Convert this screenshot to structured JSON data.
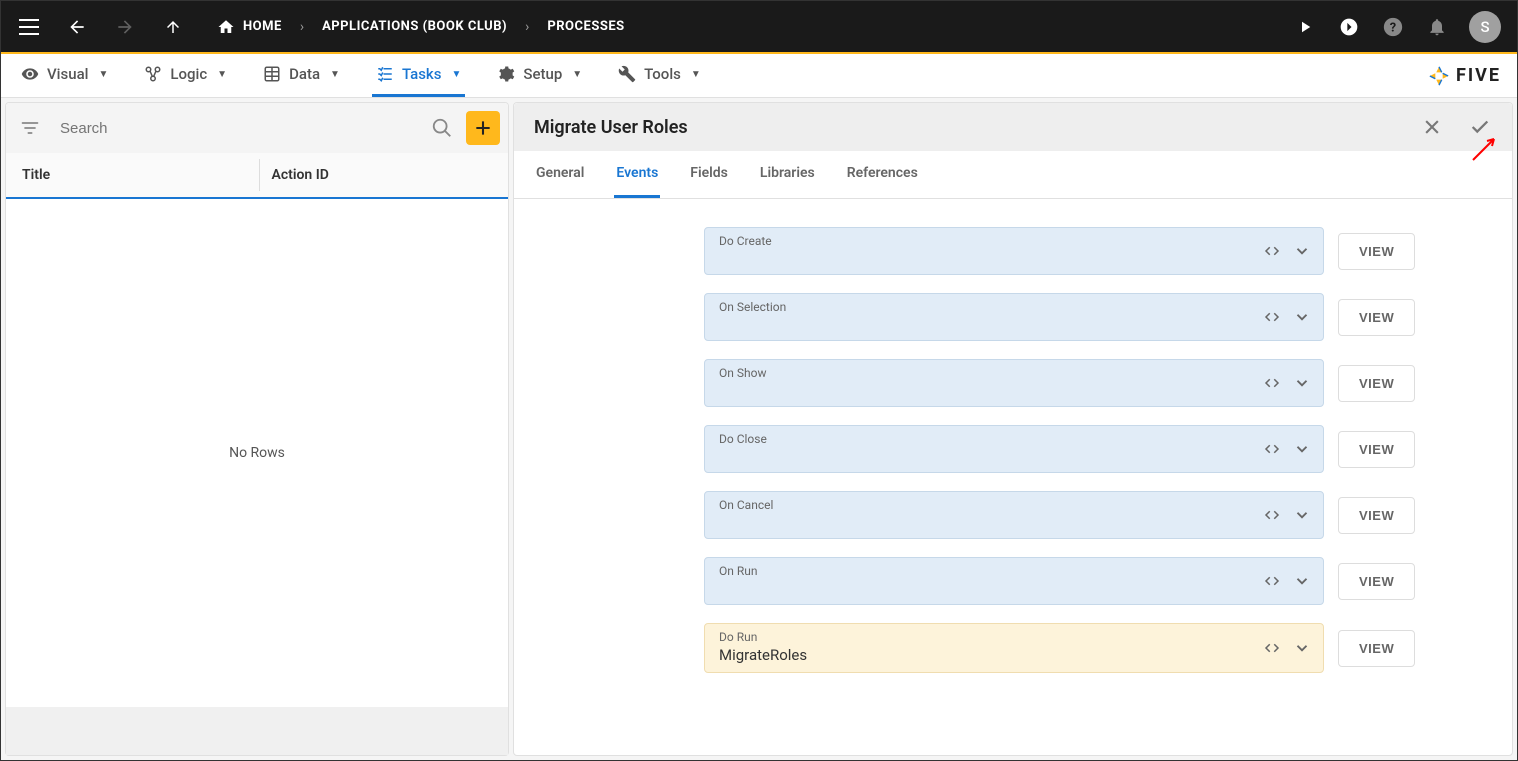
{
  "topbar": {
    "breadcrumbs": [
      {
        "label": "HOME",
        "icon": "home"
      },
      {
        "label": "APPLICATIONS (BOOK CLUB)"
      },
      {
        "label": "PROCESSES"
      }
    ],
    "avatar_letter": "S"
  },
  "main_tabs": [
    {
      "label": "Visual",
      "icon": "eye"
    },
    {
      "label": "Logic",
      "icon": "logic"
    },
    {
      "label": "Data",
      "icon": "table"
    },
    {
      "label": "Tasks",
      "icon": "tasks",
      "active": true
    },
    {
      "label": "Setup",
      "icon": "gear"
    },
    {
      "label": "Tools",
      "icon": "wrench"
    }
  ],
  "brand": "FIVE",
  "left_panel": {
    "search_placeholder": "Search",
    "columns": {
      "title": "Title",
      "action_id": "Action ID"
    },
    "empty_message": "No Rows"
  },
  "detail": {
    "title": "Migrate User Roles",
    "tabs": [
      "General",
      "Events",
      "Fields",
      "Libraries",
      "References"
    ],
    "active_tab": "Events",
    "events": [
      {
        "label": "Do Create",
        "value": "",
        "highlighted": false
      },
      {
        "label": "On Selection",
        "value": "",
        "highlighted": false
      },
      {
        "label": "On Show",
        "value": "",
        "highlighted": false
      },
      {
        "label": "Do Close",
        "value": "",
        "highlighted": false
      },
      {
        "label": "On Cancel",
        "value": "",
        "highlighted": false
      },
      {
        "label": "On Run",
        "value": "",
        "highlighted": false
      },
      {
        "label": "Do Run",
        "value": "MigrateRoles",
        "highlighted": true
      }
    ],
    "view_button_label": "VIEW"
  }
}
